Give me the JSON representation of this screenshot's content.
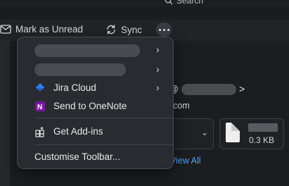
{
  "header": {
    "search_label": "Search"
  },
  "toolbar": {
    "mark_unread_label": "Mark as Unread",
    "sync_label": "Sync"
  },
  "menu": {
    "items": [
      {
        "label": "",
        "has_submenu": true
      },
      {
        "label": "",
        "has_submenu": true
      },
      {
        "label": "Jira Cloud",
        "has_submenu": true,
        "icon": "jira-icon"
      },
      {
        "label": "Send to OneNote",
        "has_submenu": false,
        "icon": "onenote-icon"
      },
      {
        "label": "Get Add-ins",
        "has_submenu": false,
        "icon": "add-ins-icon"
      },
      {
        "label": "Customise Toolbar...",
        "has_submenu": false
      }
    ]
  },
  "message": {
    "sender_prefix": "a@",
    "sender_suffix": ">",
    "email_domain_tail": "com",
    "attachment_size": "0.3 KB",
    "view_all_label": "View All"
  },
  "colors": {
    "accent_link": "#4aa3ff",
    "jira_blue": "#2684ff",
    "onenote_purple": "#7719aa"
  }
}
